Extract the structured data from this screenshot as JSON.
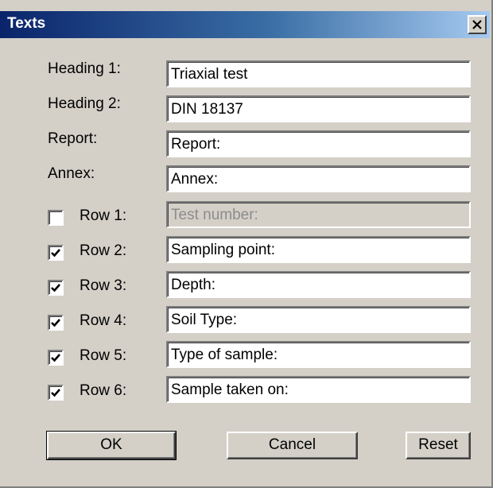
{
  "window": {
    "title": "Texts"
  },
  "fields": [
    {
      "label": "Heading 1:",
      "value": "Triaxial test"
    },
    {
      "label": "Heading 2:",
      "value": "DIN 18137"
    },
    {
      "label": "Report:",
      "value": "Report:"
    },
    {
      "label": "Annex:",
      "value": "Annex:"
    }
  ],
  "rows": [
    {
      "label": "Row 1:",
      "value": "Test number:",
      "checked": false,
      "enabled": false
    },
    {
      "label": "Row 2:",
      "value": "Sampling point:",
      "checked": true,
      "enabled": true
    },
    {
      "label": "Row 3:",
      "value": "Depth:",
      "checked": true,
      "enabled": true
    },
    {
      "label": "Row 4:",
      "value": "Soil Type:",
      "checked": true,
      "enabled": true
    },
    {
      "label": "Row 5:",
      "value": "Type of sample:",
      "checked": true,
      "enabled": true
    },
    {
      "label": "Row 6:",
      "value": "Sample taken on:",
      "checked": true,
      "enabled": true
    }
  ],
  "buttons": {
    "ok": "OK",
    "cancel": "Cancel",
    "reset": "Reset"
  }
}
